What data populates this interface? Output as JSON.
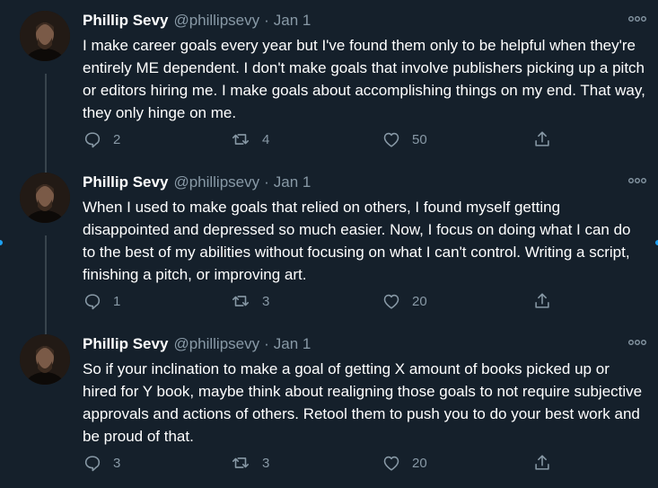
{
  "thread": {
    "tweets": [
      {
        "name": "Phillip Sevy",
        "handle": "@phillipsevy",
        "separator": "·",
        "date": "Jan 1",
        "text": "I make career goals every year but I've found them only to be helpful when they're entirely ME dependent. I don't make goals that involve publishers picking up a pitch or editors hiring me. I make goals about accomplishing things on my end. That way, they only hinge on me.",
        "replies": "2",
        "retweets": "4",
        "likes": "50"
      },
      {
        "name": "Phillip Sevy",
        "handle": "@phillipsevy",
        "separator": "·",
        "date": "Jan 1",
        "text": "When I used to make goals that relied on others, I found myself getting disappointed and depressed so much easier. Now, I focus on doing what I can do to the best of my abilities without focusing on what I can't control. Writing a script, finishing a pitch, or improving art.",
        "replies": "1",
        "retweets": "3",
        "likes": "20"
      },
      {
        "name": "Phillip Sevy",
        "handle": "@phillipsevy",
        "separator": "·",
        "date": "Jan 1",
        "text": "So if your inclination to make a goal of getting X amount of books picked up or hired for Y book, maybe think about realigning those goals to not require subjective approvals and actions of others. Retool them to push you to do your best work and be proud of that.",
        "replies": "3",
        "retweets": "3",
        "likes": "20"
      }
    ]
  },
  "icons": {
    "reply": "reply-icon",
    "retweet": "retweet-icon",
    "like": "heart-icon",
    "share": "share-icon",
    "more": "more-icon"
  },
  "colors": {
    "background": "#15202b",
    "text_primary": "#ffffff",
    "text_secondary": "#8899a6",
    "thread_line": "#38444d",
    "accent": "#1da1f2"
  }
}
